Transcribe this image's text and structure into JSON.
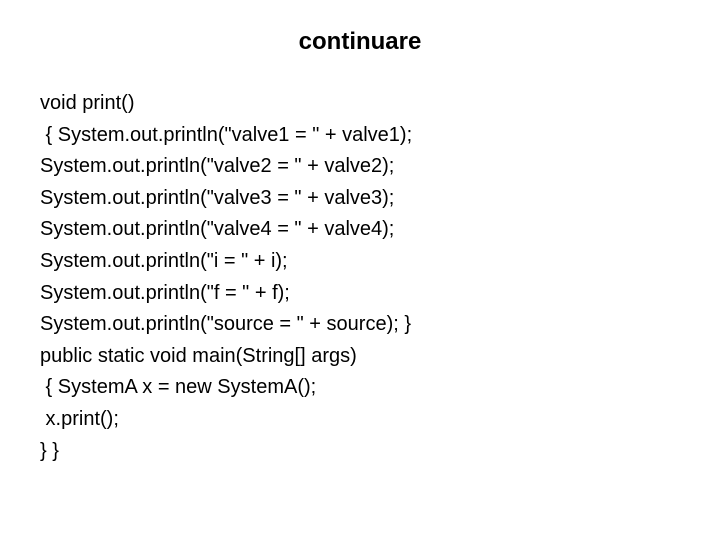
{
  "title": "continuare",
  "code_lines": [
    "void print()",
    " { System.out.println(\"valve1 = \" + valve1);",
    "System.out.println(\"valve2 = \" + valve2);",
    "System.out.println(\"valve3 = \" + valve3);",
    "System.out.println(\"valve4 = \" + valve4);",
    "System.out.println(\"i = \" + i);",
    "System.out.println(\"f = \" + f);",
    "System.out.println(\"source = \" + source); }",
    "public static void main(String[] args)",
    " { SystemA x = new SystemA();",
    " x.print();",
    "} }"
  ]
}
